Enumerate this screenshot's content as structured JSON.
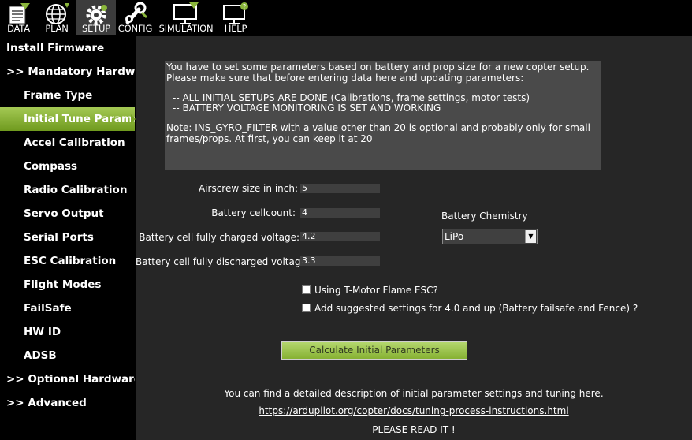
{
  "toolbar": {
    "items": [
      {
        "label": "DATA",
        "icon": "data-icon"
      },
      {
        "label": "PLAN",
        "icon": "plan-globe-icon"
      },
      {
        "label": "SETUP",
        "icon": "setup-gear-icon"
      },
      {
        "label": "CONFIG",
        "icon": "config-wrench-icon"
      },
      {
        "label": "SIMULATION",
        "icon": "simulation-monitor-icon"
      },
      {
        "label": "HELP",
        "icon": "help-monitor-icon"
      }
    ],
    "active": "SETUP"
  },
  "sidebar": {
    "items": [
      {
        "label": "Install Firmware"
      },
      {
        "label": ">> Mandatory Hardware"
      },
      {
        "label": "Frame Type"
      },
      {
        "label": "Initial Tune Paramet"
      },
      {
        "label": "Accel Calibration"
      },
      {
        "label": "Compass"
      },
      {
        "label": "Radio Calibration"
      },
      {
        "label": "Servo Output"
      },
      {
        "label": "Serial Ports"
      },
      {
        "label": "ESC Calibration"
      },
      {
        "label": "Flight Modes"
      },
      {
        "label": "FailSafe"
      },
      {
        "label": "HW ID"
      },
      {
        "label": "ADSB"
      },
      {
        "label": ">> Optional Hardware"
      },
      {
        "label": ">> Advanced"
      }
    ],
    "selected": "Initial Tune Paramet"
  },
  "info": {
    "lines": [
      "You have to set some parameters based on battery and prop size for a new copter setup.",
      "Please make sure that before entering data here and updating parameters:",
      "-- ALL INITIAL SETUPS ARE DONE (Calibrations, frame settings, motor tests)",
      "-- BATTERY VOLTAGE MONITORING IS SET AND WORKING",
      "Note: INS_GYRO_FILTER with a value other than 20 is optional and probably only for small",
      "frames/props. At first, you can keep it at 20"
    ]
  },
  "form": {
    "airscrew_label": "Airscrew size in inch:",
    "airscrew_value": "5",
    "cellcount_label": "Battery cellcount:",
    "cellcount_value": "4",
    "charged_label": "Battery cell fully charged voltage:",
    "charged_value": "4.2",
    "discharged_label": "Battery cell fully discharged voltage:",
    "discharged_value": "3.3",
    "chemistry_label": "Battery Chemistry",
    "chemistry_value": "LiPo",
    "tmotor_label": "Using T-Motor Flame ESC?",
    "suggested_label": "Add suggested settings for 4.0 and up (Battery failsafe and Fence) ?",
    "calc_button": "Calculate Initial Parameters"
  },
  "footer": {
    "description": "You can find a detailed description of initial parameter settings and tuning here.",
    "link": "https://ardupilot.org/copter/docs/tuning-process-instructions.html",
    "note": "PLEASE READ IT !"
  },
  "colors": {
    "accent": "#8ab63b",
    "panel": "#4a4a4a",
    "background": "#262626"
  }
}
